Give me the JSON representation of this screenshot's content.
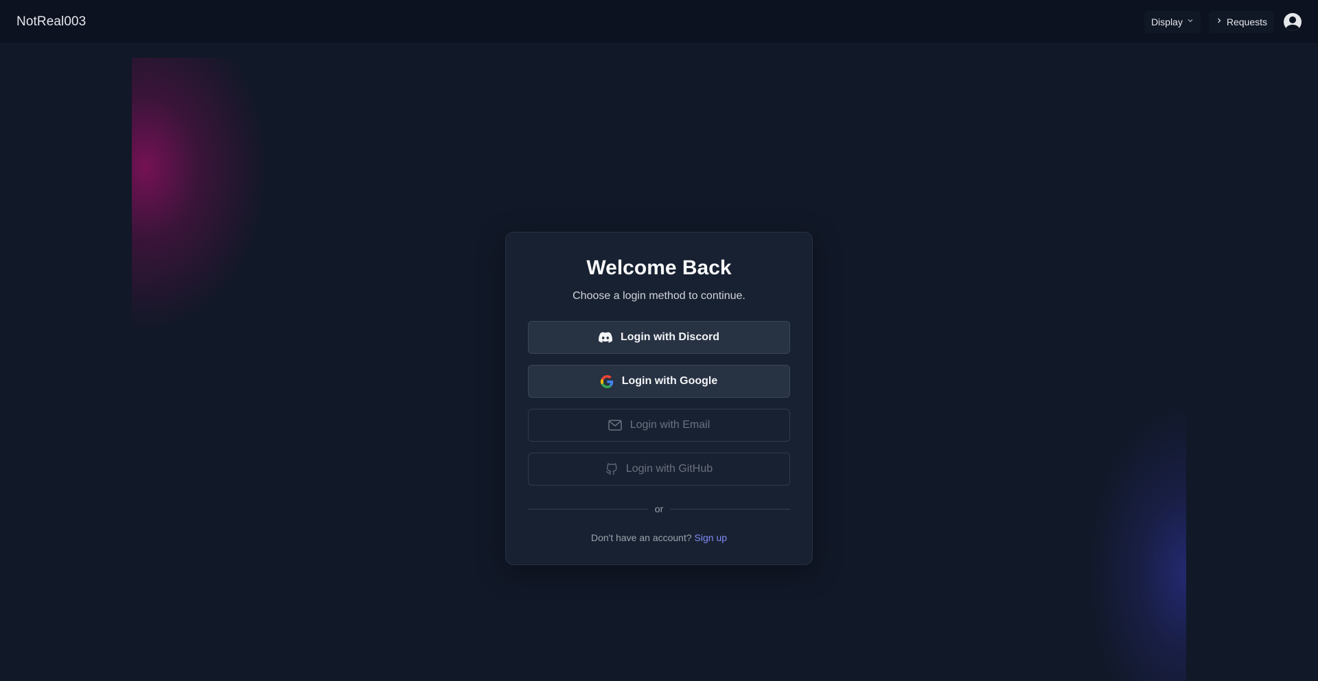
{
  "header": {
    "brand": "NotReal003",
    "display_label": "Display",
    "requests_label": "Requests"
  },
  "login": {
    "title": "Welcome Back",
    "subtitle": "Choose a login method to continue.",
    "discord_label": "Login with Discord",
    "google_label": "Login with Google",
    "email_label": "Login with Email",
    "github_label": "Login with GitHub",
    "divider_text": "or",
    "signup_prompt": "Don't have an account?",
    "signup_link": "Sign up"
  },
  "colors": {
    "background": "#111827",
    "card": "#182131",
    "accent_link": "#818cf8",
    "glow_magenta": "#96106a",
    "glow_indigo": "#282d82"
  },
  "icons": {
    "display": "chevron-down-icon",
    "requests": "chevron-right-icon",
    "avatar": "user-circle-icon",
    "discord": "discord-icon",
    "google": "google-icon",
    "email": "mail-icon",
    "github": "github-icon"
  }
}
